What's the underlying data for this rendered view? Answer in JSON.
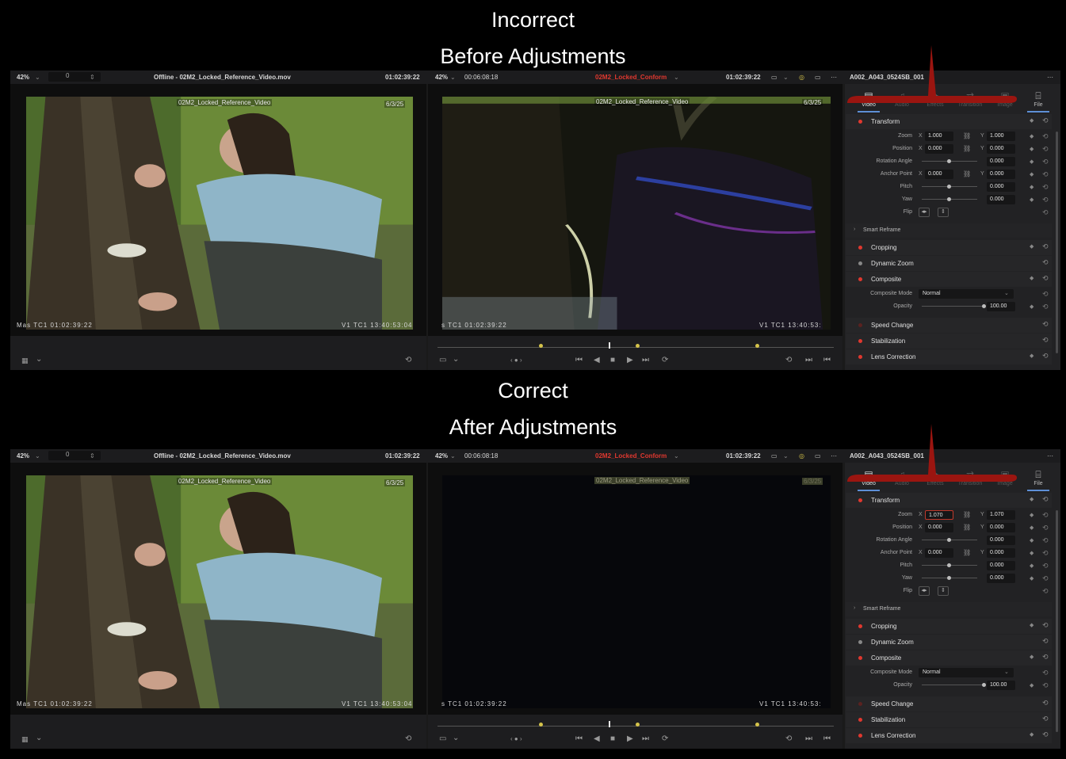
{
  "headings": {
    "top_1": "Incorrect",
    "top_2": "Before Adjustments",
    "bottom_1": "Correct",
    "bottom_2": "After Adjustments"
  },
  "panels": [
    {
      "source_zoom": "42%",
      "source_frame": "0",
      "source_title": "Offline - 02M2_Locked_Reference_Video.mov",
      "source_tc": "01:02:39:22",
      "target_zoom": "42%",
      "target_duration": "00:06:08:18",
      "target_title": "02M2_Locked_Conform",
      "target_tc": "01:02:39:22",
      "clip_name": "A002_A043_0524SB_001",
      "src_overlay_label": "02M2_Locked_Reference_Video",
      "src_overlay_date": "6/3/25",
      "tgt_overlay_label": "02M2_Locked_Reference_Video",
      "tgt_overlay_date": "6/3/25",
      "src_tc_left": "Mas  TC1   01:02:39:22",
      "src_tc_right": "V1  TC1    13:40:53:04",
      "tgt_tc_left": "s  TC1   01:02:39:22",
      "tgt_tc_right": "V1  TC1    13:40:53:",
      "zoom_x": "1.000",
      "zoom_y": "1.000",
      "tgt_dark": false
    },
    {
      "source_zoom": "42%",
      "source_frame": "0",
      "source_title": "Offline - 02M2_Locked_Reference_Video.mov",
      "source_tc": "01:02:39:22",
      "target_zoom": "42%",
      "target_duration": "00:06:08:18",
      "target_title": "02M2_Locked_Conform",
      "target_tc": "01:02:39:22",
      "clip_name": "A002_A043_0524SB_001",
      "src_overlay_label": "02M2_Locked_Reference_Video",
      "src_overlay_date": "6/3/25",
      "tgt_overlay_label": "02M2_Locked_Reference_Video",
      "tgt_overlay_date": "6/3/25",
      "src_tc_left": "Mas  TC1   01:02:39:22",
      "src_tc_right": "V1  TC1    13:40:53:04",
      "tgt_tc_left": "s  TC1   01:02:39:22",
      "tgt_tc_right": "V1  TC1    13:40:53:",
      "zoom_x": "1.070",
      "zoom_y": "1.070",
      "tgt_dark": true
    }
  ],
  "inspector": {
    "tabs": [
      "Video",
      "Audio",
      "Effects",
      "Transition",
      "Image",
      "File"
    ],
    "transform_label": "Transform",
    "zoom_label": "Zoom",
    "position_label": "Position",
    "rotation_label": "Rotation Angle",
    "anchor_label": "Anchor Point",
    "pitch_label": "Pitch",
    "yaw_label": "Yaw",
    "flip_label": "Flip",
    "axis_x": "X",
    "axis_y": "Y",
    "position_x": "0.000",
    "position_y": "0.000",
    "rotation": "0.000",
    "anchor_x": "0.000",
    "anchor_y": "0.000",
    "pitch": "0.000",
    "yaw": "0.000",
    "smart_reframe": "Smart Reframe",
    "cropping": "Cropping",
    "dynamic_zoom": "Dynamic Zoom",
    "composite": "Composite",
    "composite_mode_label": "Composite Mode",
    "composite_mode": "Normal",
    "opacity_label": "Opacity",
    "opacity": "100.00",
    "speed_change": "Speed Change",
    "stabilization": "Stabilization",
    "lens_correction": "Lens Correction"
  },
  "colors": {
    "accent_red": "#c0392b",
    "annotation_red": "#9b1510",
    "marker_yellow": "#d4c34a",
    "tab_blue": "#5d8fd6"
  },
  "icons": [
    "chevron-down-icon",
    "stepper-icon",
    "link-icon",
    "keyframe-diamond-icon",
    "reset-icon",
    "play-icon",
    "stop-icon",
    "loop-icon",
    "skip-start-icon",
    "skip-end-icon",
    "checkerboard-icon",
    "more-icon",
    "video-tab-icon",
    "audio-tab-icon",
    "file-tab-icon"
  ]
}
